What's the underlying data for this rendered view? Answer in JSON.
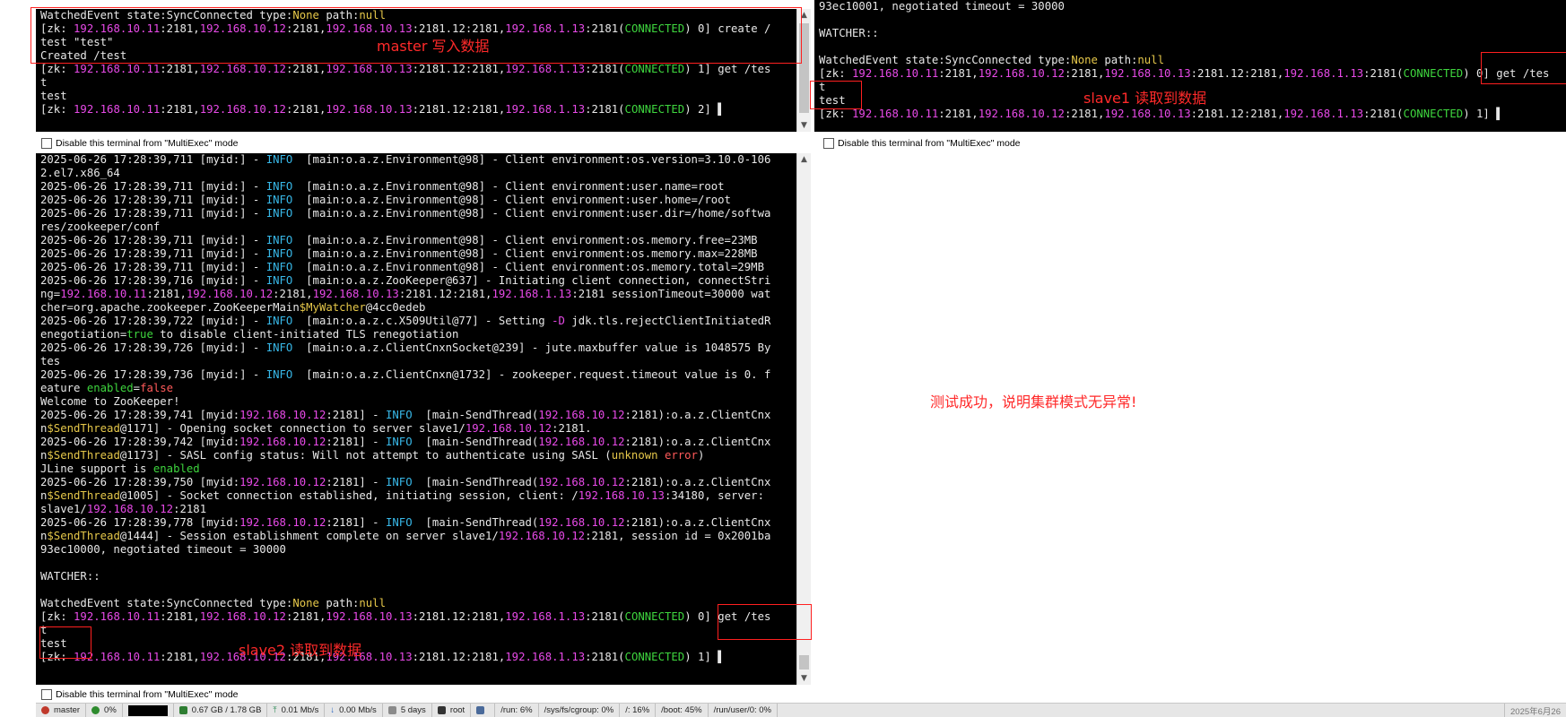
{
  "panes": {
    "master": {
      "lines": [
        "WatchedEvent state:SyncConnected type:None path:null",
        "[zk: 192.168.10.11:2181,192.168.10.12:2181,192.168.10.13:2181.12:2181,192.168.1.13:2181(CONNECTED) 0] create /",
        "test \"test\"",
        "Created /test",
        "[zk: 192.168.10.11:2181,192.168.10.12:2181,192.168.10.13:2181.12:2181,192.168.1.13:2181(CONNECTED) 1] get /tes",
        "t",
        "test",
        "[zk: 192.168.10.11:2181,192.168.10.12:2181,192.168.10.13:2181.12:2181,192.168.1.13:2181(CONNECTED) 2] ▌"
      ]
    },
    "slave1": {
      "lines": [
        "93ec10001, negotiated timeout = 30000",
        "",
        "WATCHER::",
        "",
        "WatchedEvent state:SyncConnected type:None path:null",
        "[zk: 192.168.10.11:2181,192.168.10.12:2181,192.168.10.13:2181.12:2181,192.168.1.13:2181(CONNECTED) 0] get /tes",
        "t",
        "test",
        "[zk: 192.168.10.11:2181,192.168.10.12:2181,192.168.10.13:2181.12:2181,192.168.1.13:2181(CONNECTED) 1] ▌"
      ]
    },
    "slave2": {
      "lines": [
        "2025-06-26 17:28:39,711 [myid:] - INFO  [main:o.a.z.Environment@98] - Client environment:os.version=3.10.0-106",
        "2.el7.x86_64",
        "2025-06-26 17:28:39,711 [myid:] - INFO  [main:o.a.z.Environment@98] - Client environment:user.name=root",
        "2025-06-26 17:28:39,711 [myid:] - INFO  [main:o.a.z.Environment@98] - Client environment:user.home=/root",
        "2025-06-26 17:28:39,711 [myid:] - INFO  [main:o.a.z.Environment@98] - Client environment:user.dir=/home/softwa",
        "res/zookeeper/conf",
        "2025-06-26 17:28:39,711 [myid:] - INFO  [main:o.a.z.Environment@98] - Client environment:os.memory.free=23MB",
        "2025-06-26 17:28:39,711 [myid:] - INFO  [main:o.a.z.Environment@98] - Client environment:os.memory.max=228MB",
        "2025-06-26 17:28:39,711 [myid:] - INFO  [main:o.a.z.Environment@98] - Client environment:os.memory.total=29MB",
        "2025-06-26 17:28:39,716 [myid:] - INFO  [main:o.a.z.ZooKeeper@637] - Initiating client connection, connectStri",
        "ng=192.168.10.11:2181,192.168.10.12:2181,192.168.10.13:2181.12:2181,192.168.1.13:2181 sessionTimeout=30000 wat",
        "cher=org.apache.zookeeper.ZooKeeperMain$MyWatcher@4cc0edeb",
        "2025-06-26 17:28:39,722 [myid:] - INFO  [main:o.a.z.c.X509Util@77] - Setting -D jdk.tls.rejectClientInitiatedR",
        "enegotiation=true to disable client-initiated TLS renegotiation",
        "2025-06-26 17:28:39,726 [myid:] - INFO  [main:o.a.z.ClientCnxnSocket@239] - jute.maxbuffer value is 1048575 By",
        "tes",
        "2025-06-26 17:28:39,736 [myid:] - INFO  [main:o.a.z.ClientCnxn@1732] - zookeeper.request.timeout value is 0. f",
        "eature enabled=false",
        "Welcome to ZooKeeper!",
        "2025-06-26 17:28:39,741 [myid:192.168.10.12:2181] - INFO  [main-SendThread(192.168.10.12:2181):o.a.z.ClientCnx",
        "n$SendThread@1171] - Opening socket connection to server slave1/192.168.10.12:2181.",
        "2025-06-26 17:28:39,742 [myid:192.168.10.12:2181] - INFO  [main-SendThread(192.168.10.12:2181):o.a.z.ClientCnx",
        "n$SendThread@1173] - SASL config status: Will not attempt to authenticate using SASL (unknown error)",
        "JLine support is enabled",
        "2025-06-26 17:28:39,750 [myid:192.168.10.12:2181] - INFO  [main-SendThread(192.168.10.12:2181):o.a.z.ClientCnx",
        "n$SendThread@1005] - Socket connection established, initiating session, client: /192.168.10.13:34180, server:",
        "slave1/192.168.10.12:2181",
        "2025-06-26 17:28:39,778 [myid:192.168.10.12:2181] - INFO  [main-SendThread(192.168.10.12:2181):o.a.z.ClientCnx",
        "n$SendThread@1444] - Session establishment complete on server slave1/192.168.10.12:2181, session id = 0x2001ba",
        "93ec10000, negotiated timeout = 30000",
        "",
        "WATCHER::",
        "",
        "WatchedEvent state:SyncConnected type:None path:null",
        "[zk: 192.168.10.11:2181,192.168.10.12:2181,192.168.10.13:2181.12:2181,192.168.1.13:2181(CONNECTED) 0] get /tes",
        "t",
        "test",
        "[zk: 192.168.10.11:2181,192.168.10.12:2181,192.168.10.13:2181.12:2181,192.168.1.13:2181(CONNECTED) 1] ▌"
      ]
    }
  },
  "disable_label": "Disable this terminal from \"MultiExec\" mode",
  "annotations": {
    "master": "master 写入数据",
    "slave1": "slave1 读取到数据",
    "slave2": "slave2 读取到数据",
    "success": "测试成功，说明集群模式无异常!"
  },
  "statusbar": {
    "host": "master",
    "cpu": "0%",
    "memory": "0.67 GB / 1.78 GB",
    "upload": "0.01 Mb/s",
    "download": "0.00 Mb/s",
    "uptime": "5 days",
    "user": "root",
    "disks": [
      "/run: 6%",
      "/sys/fs/cgroup: 0%",
      "/: 16%",
      "/boot: 45%",
      "/run/user/0: 0%"
    ],
    "clock": "2025年6月26"
  },
  "colors": {
    "ip": "#e84ae8",
    "connected": "#3ed53e",
    "info": "#38b8e8",
    "keyword": "#e6c84a",
    "annotation": "#ff2a2a"
  }
}
